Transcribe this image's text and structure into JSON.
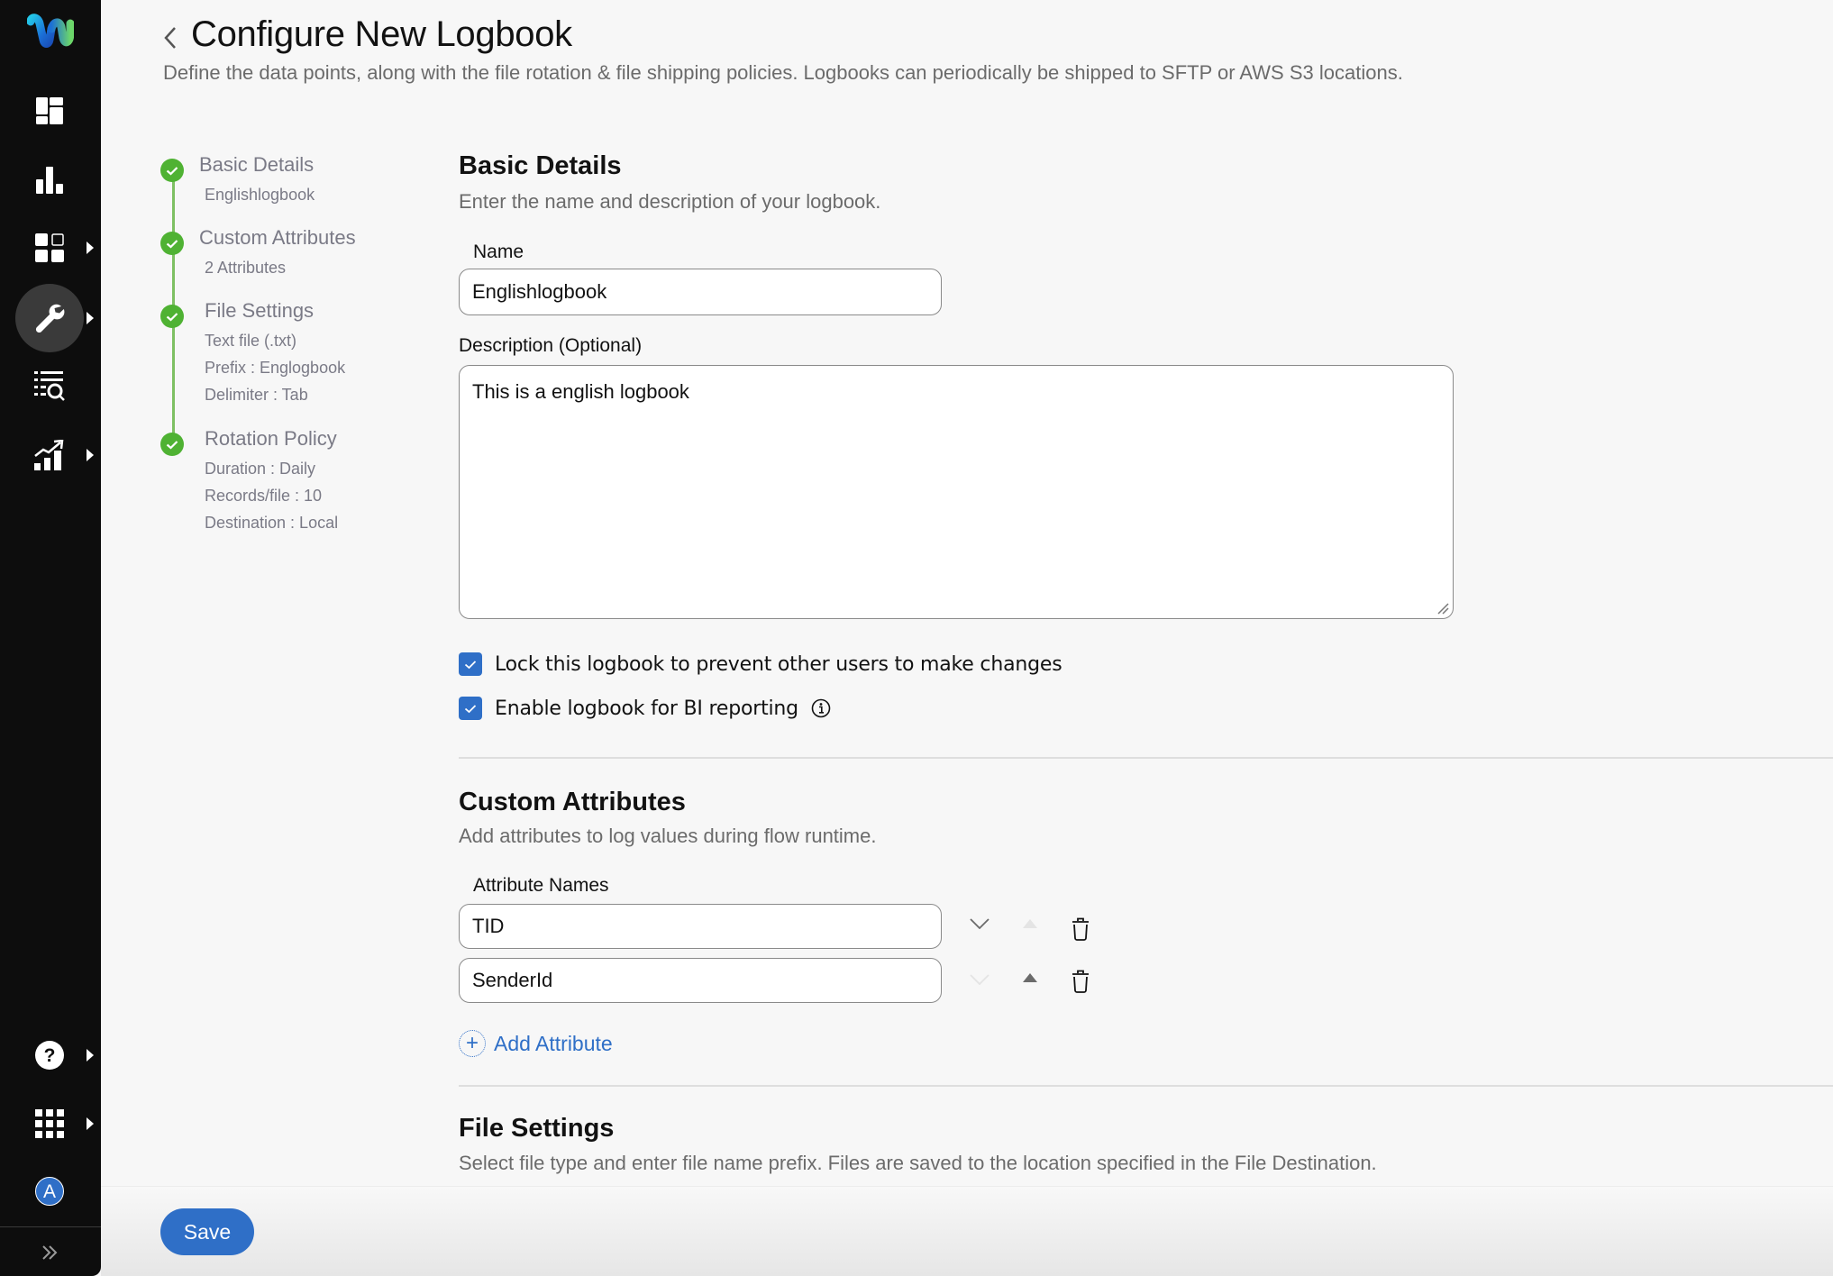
{
  "sidebar": {
    "items": [
      {
        "name": "logo",
        "icon": "webex-logo-icon"
      },
      {
        "name": "dashboard",
        "icon": "dashboard-icon",
        "has_submenu": false
      },
      {
        "name": "analytics",
        "icon": "bar-chart-icon",
        "has_submenu": false
      },
      {
        "name": "apps",
        "icon": "grid-apps-icon",
        "has_submenu": true
      },
      {
        "name": "tools",
        "icon": "wrench-icon",
        "has_submenu": true,
        "active": true
      },
      {
        "name": "logs",
        "icon": "list-search-icon",
        "has_submenu": false
      },
      {
        "name": "reports",
        "icon": "trend-chart-icon",
        "has_submenu": true
      },
      {
        "name": "help",
        "icon": "help-icon",
        "has_submenu": true
      },
      {
        "name": "app-launcher",
        "icon": "app-grid-icon",
        "has_submenu": true
      }
    ],
    "avatar_initial": "A",
    "expand_icon": "double-chevron-right-icon"
  },
  "header": {
    "title": "Configure New Logbook",
    "subtitle": "Define the data points, along with the file rotation & file shipping policies. Logbooks can periodically be shipped to SFTP or AWS S3 locations."
  },
  "stepper": {
    "steps": [
      {
        "title": "Basic Details",
        "details": [
          "Englishlogbook"
        ],
        "status": "complete"
      },
      {
        "title": "Custom Attributes",
        "details": [
          "2 Attributes"
        ],
        "status": "complete"
      },
      {
        "title": "File Settings",
        "details": [
          "Text file (.txt)",
          "Prefix : Englogbook",
          "Delimiter : Tab"
        ],
        "status": "complete"
      },
      {
        "title": "Rotation Policy",
        "details": [
          "Duration : Daily",
          "Records/file : 10",
          "Destination : Local"
        ],
        "status": "complete"
      }
    ]
  },
  "basic_details": {
    "title": "Basic Details",
    "description": "Enter the name and description of your logbook.",
    "name_label": "Name",
    "name_value": "Englishlogbook",
    "description_label": "Description (Optional)",
    "description_value": "This is a english logbook",
    "lock_label": "Lock this logbook to prevent other users to make changes",
    "lock_checked": true,
    "bi_label": "Enable logbook for BI reporting",
    "bi_checked": true
  },
  "custom_attributes": {
    "title": "Custom Attributes",
    "description": "Add attributes to log values during flow runtime.",
    "column_label": "Attribute Names",
    "attributes": [
      {
        "value": "TID",
        "move_down_enabled": true,
        "move_up_enabled": false
      },
      {
        "value": "SenderId",
        "move_down_enabled": false,
        "move_up_enabled": true
      }
    ],
    "add_label": "Add Attribute"
  },
  "file_settings": {
    "title": "File Settings",
    "description": "Select file type and enter file name prefix. Files are saved to the location specified in the File Destination."
  },
  "footer": {
    "save_label": "Save"
  },
  "colors": {
    "accent": "#2f6fc7",
    "success": "#4fb233",
    "sidebar_bg": "#0d0d0d"
  }
}
